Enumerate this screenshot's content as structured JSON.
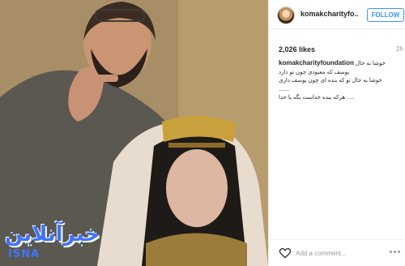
{
  "post": {
    "watermark_arabic": "خبرآنلاين",
    "watermark_latin": "ISNA"
  },
  "sidebar": {
    "username": "komakcharityfo...",
    "follow_label": "FOLLOW",
    "likes": "2,026 likes",
    "age": "2h",
    "caption": {
      "username": "komakcharityfoundation",
      "first_line": "خوشا به حال",
      "lines": [
        "یوسف که معبودی چون تو دارد",
        "خوشا به حال تو که بنده ای چون یوسف داری",
        ".......",
        "..... هرکه بنده خداست بگه یا خدا"
      ]
    },
    "comment_placeholder": "Add a comment...",
    "icons": {
      "like": "heart-icon",
      "more": "more-options-icon"
    }
  }
}
